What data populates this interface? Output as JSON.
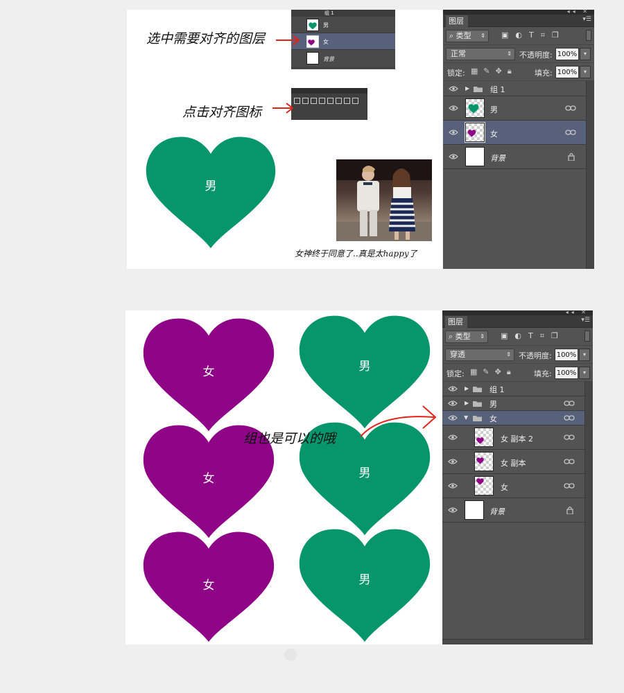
{
  "panel": {
    "tab_label": "图层",
    "menu_icon": "panel-menu-icon",
    "filter_label": "类型",
    "opacity_label": "不透明度:",
    "opacity_value": "100%",
    "lock_label": "锁定:",
    "fill_label": "填充:",
    "fill_value": "100%"
  },
  "section1": {
    "annotation_select": "选中需要对齐的图层",
    "annotation_align": "点击对齐图标",
    "heart_label": "男",
    "photo_caption": "女神终于同意了..真是太happy了",
    "blend_mode": "正常",
    "mini_layers": [
      "组 1",
      "男",
      "女",
      "背景"
    ],
    "layers": [
      {
        "name": "组 1",
        "type": "group"
      },
      {
        "name": "男",
        "type": "layer"
      },
      {
        "name": "女",
        "type": "layer",
        "selected": true
      },
      {
        "name": "背景",
        "type": "background"
      }
    ]
  },
  "section2": {
    "heart_left_label": "女",
    "heart_right_label": "男",
    "annotation_group": "组也是可以的哦",
    "blend_mode": "穿透",
    "layers": [
      {
        "name": "组 1",
        "type": "group"
      },
      {
        "name": "男",
        "type": "group"
      },
      {
        "name": "女",
        "type": "group",
        "expanded": true,
        "selected": true
      },
      {
        "name": "女 副本 2",
        "type": "layer"
      },
      {
        "name": "女 副本",
        "type": "layer"
      },
      {
        "name": "女",
        "type": "layer"
      },
      {
        "name": "背景",
        "type": "background"
      }
    ]
  },
  "colors": {
    "green_heart": "#07966b",
    "purple_heart": "#8f0387",
    "panel_bg": "#535353",
    "selected_row": "#57617a",
    "arrow_red": "#e2231a"
  }
}
